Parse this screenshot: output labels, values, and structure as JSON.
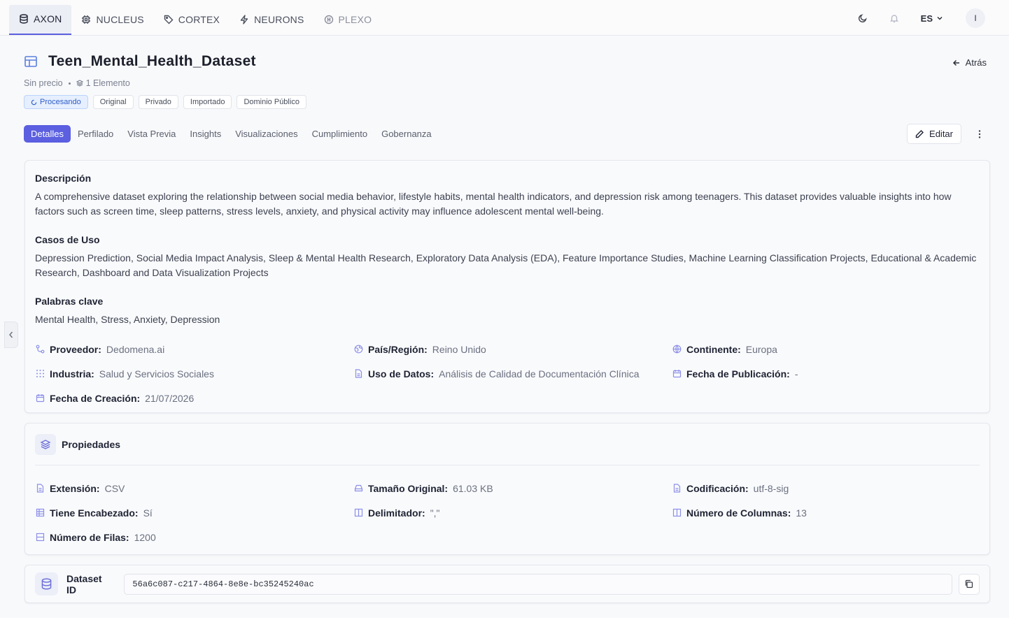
{
  "nav": {
    "tabs": [
      {
        "label": "AXON",
        "icon": "database-icon",
        "active": true
      },
      {
        "label": "NUCLEUS",
        "icon": "chip-icon"
      },
      {
        "label": "CORTEX",
        "icon": "tag-icon"
      },
      {
        "label": "NEURONS",
        "icon": "lightning-icon"
      },
      {
        "label": "PLEXO",
        "icon": "plexo-icon"
      }
    ],
    "language": "ES",
    "avatar_initial": "I"
  },
  "header": {
    "title": "Teen_Mental_Health_Dataset",
    "back_label": "Atrás",
    "price": "Sin precio",
    "elements": "1 Elemento",
    "badges": [
      "Procesando",
      "Original",
      "Privado",
      "Importado",
      "Dominio Público"
    ]
  },
  "subtabs": [
    "Detalles",
    "Perfilado",
    "Vista Previa",
    "Insights",
    "Visualizaciones",
    "Cumplimiento",
    "Gobernanza"
  ],
  "edit_label": "Editar",
  "details": {
    "description_title": "Descripción",
    "description": "A comprehensive dataset exploring the relationship between social media behavior, lifestyle habits, mental health indicators, and depression risk among teenagers. This dataset provides valuable insights into how factors such as screen time, sleep patterns, stress levels, anxiety, and physical activity may influence adolescent mental well-being.",
    "use_cases_title": "Casos de Uso",
    "use_cases": "Depression Prediction, Social Media Impact Analysis, Sleep & Mental Health Research, Exploratory Data Analysis (EDA), Feature Importance Studies, Machine Learning Classification Projects, Educational & Academic Research, Dashboard and Data Visualization Projects",
    "keywords_title": "Palabras clave",
    "keywords": "Mental Health, Stress, Anxiety, Depression",
    "fields": [
      {
        "label": "Proveedor:",
        "value": "Dedomena.ai",
        "icon": "provider-icon"
      },
      {
        "label": "País/Región:",
        "value": "Reino Unido",
        "icon": "globe-icon"
      },
      {
        "label": "Continente:",
        "value": "Europa",
        "icon": "world-icon"
      },
      {
        "label": "Industria:",
        "value": "Salud y Servicios Sociales",
        "icon": "grid-icon"
      },
      {
        "label": "Uso de Datos:",
        "value": "Análisis de Calidad de Documentación Clínica",
        "icon": "file-icon"
      },
      {
        "label": "Fecha de Publicación:",
        "value": "-",
        "icon": "calendar-icon"
      },
      {
        "label": "Fecha de Creación:",
        "value": "21/07/2026",
        "icon": "calendar-icon"
      }
    ]
  },
  "properties": {
    "title": "Propiedades",
    "fields": [
      {
        "label": "Extensión:",
        "value": "CSV",
        "icon": "file-icon"
      },
      {
        "label": "Tamaño Original:",
        "value": "61.03 KB",
        "icon": "drive-icon"
      },
      {
        "label": "Codificación:",
        "value": "utf-8-sig",
        "icon": "file-icon"
      },
      {
        "label": "Tiene Encabezado:",
        "value": "Sí",
        "icon": "table-icon"
      },
      {
        "label": "Delimitador:",
        "value": "\",\"",
        "icon": "columns-icon"
      },
      {
        "label": "Número de Columnas:",
        "value": "13",
        "icon": "columns-icon"
      },
      {
        "label": "Número de Filas:",
        "value": "1200",
        "icon": "rows-icon"
      }
    ]
  },
  "dataset_id": {
    "label": "Dataset ID",
    "value": "56a6c087-c217-4864-8e8e-bc35245240ac"
  },
  "colors": {
    "accent": "#5b5fe0",
    "processing": "#2d5bc7"
  }
}
